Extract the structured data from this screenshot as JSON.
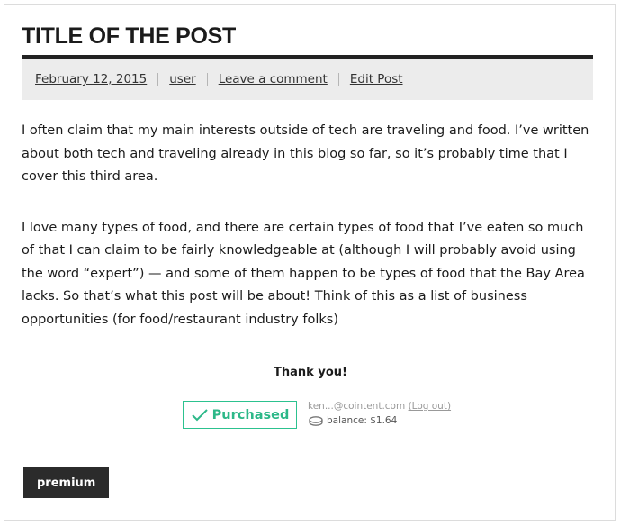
{
  "post": {
    "title": "TITLE OF THE POST",
    "meta": {
      "date": "February 12, 2015",
      "author": "user",
      "comment": "Leave a comment",
      "edit": "Edit Post"
    },
    "paragraphs": [
      "I often claim that my main interests outside of tech are traveling and food. I’ve written about both tech and traveling already in this blog so far, so it’s probably time that I cover this third area.",
      "I love many types of food, and there are certain types of food that I’ve eaten so much of that I can claim to be fairly knowledgeable at (although I will probably avoid using the word “expert”) — and some of them happen to be types of food that the Bay Area lacks. So that’s what this post will be about! Think of this as a list of business opportunities (for food/restaurant industry folks)"
    ]
  },
  "purchase": {
    "thanks": "Thank you!",
    "button_label": "Purchased",
    "account_email": "ken...@cointent.com",
    "logout_label": "(Log out)",
    "balance": "balance: $1.64",
    "icons": {
      "check": "check-icon",
      "coin": "coin-icon"
    }
  },
  "tag": {
    "label": "premium"
  },
  "colors": {
    "accent_green": "#2cb888",
    "dark": "#2b2b2b",
    "meta_bg": "#ececec"
  }
}
